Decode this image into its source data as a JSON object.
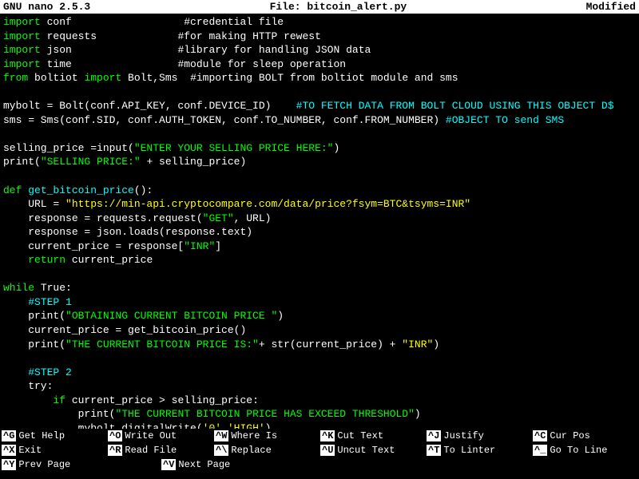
{
  "titleBar": {
    "left": "GNU nano 2.5.3",
    "center": "File: bitcoin_alert.py",
    "right": "Modified"
  },
  "shortcuts": [
    [
      {
        "key": "^G",
        "label": "Get Help"
      },
      {
        "key": "^O",
        "label": "Write Out"
      },
      {
        "key": "^W",
        "label": "Where Is"
      },
      {
        "key": "^K",
        "label": "Cut Text"
      },
      {
        "key": "^J",
        "label": "Justify"
      },
      {
        "key": "^C",
        "label": "Cur Pos"
      }
    ],
    [
      {
        "key": "^X",
        "label": "Exit"
      },
      {
        "key": "^R",
        "label": "Read File"
      },
      {
        "key": "^\\",
        "label": "Replace"
      },
      {
        "key": "^U",
        "label": "Uncut Text"
      },
      {
        "key": "^T",
        "label": "To Linter"
      },
      {
        "key": "^_",
        "label": "Go To Line"
      }
    ],
    [
      {
        "key": "^Y",
        "label": "Prev Page"
      },
      {
        "key": "^V",
        "label": "Next Page"
      }
    ]
  ]
}
